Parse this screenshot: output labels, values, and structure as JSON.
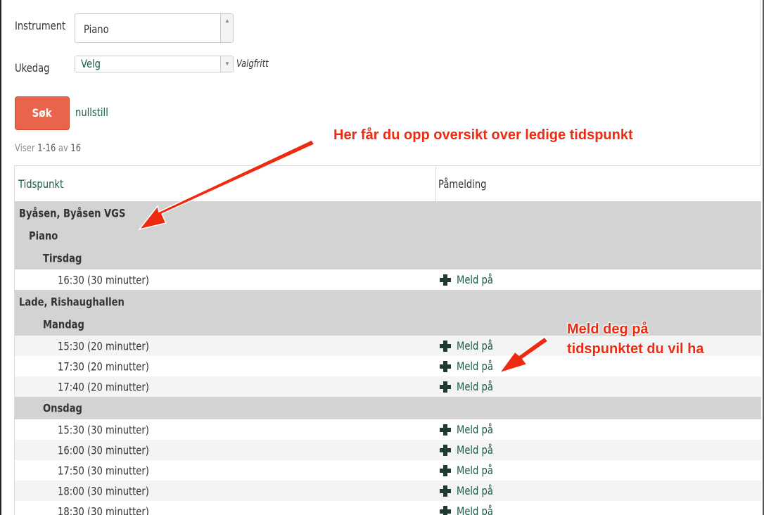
{
  "form": {
    "instrument_label": "Instrument",
    "instrument_value": "Piano",
    "weekday_label": "Ukedag",
    "weekday_value": "Velg",
    "weekday_hint": "Valgfritt",
    "search_button": "Søk",
    "reset_link": "nullstill"
  },
  "results": {
    "showing_prefix": "Viser",
    "showing_range": "1-16",
    "showing_of": "av",
    "showing_total": "16"
  },
  "table": {
    "col_time": "Tidspunkt",
    "col_signup": "Påmelding",
    "signup_label": "Meld på",
    "rows": [
      {
        "kind": "location",
        "text": "Byåsen, Byåsen VGS"
      },
      {
        "kind": "instrument",
        "text": "Piano"
      },
      {
        "kind": "day",
        "text": "Tirsdag"
      },
      {
        "kind": "slot",
        "text": "16:30 (30 minutter)"
      },
      {
        "kind": "location",
        "text": "Lade, Rishaughallen"
      },
      {
        "kind": "day",
        "text": "Mandag"
      },
      {
        "kind": "slot",
        "text": "15:30 (20 minutter)"
      },
      {
        "kind": "slot",
        "text": "17:30 (20 minutter)"
      },
      {
        "kind": "slot",
        "text": "17:40 (20 minutter)"
      },
      {
        "kind": "day",
        "text": "Onsdag"
      },
      {
        "kind": "slot",
        "text": "15:30 (30 minutter)"
      },
      {
        "kind": "slot",
        "text": "16:00 (30 minutter)"
      },
      {
        "kind": "slot",
        "text": "17:50 (30 minutter)"
      },
      {
        "kind": "slot",
        "text": "18:00 (30 minutter)"
      },
      {
        "kind": "slot",
        "text": "18:30 (30 minutter)"
      }
    ]
  },
  "annotations": {
    "overview_note": "Her får du opp oversikt over ledige tidspunkt",
    "signup_note_line1": "Meld deg på",
    "signup_note_line2": "tidspunktet du vil ha",
    "color": "#ee2a10"
  },
  "colors": {
    "button": "#e8644a",
    "link": "#1d5a4a",
    "group_bg": "#d3d3d3"
  }
}
